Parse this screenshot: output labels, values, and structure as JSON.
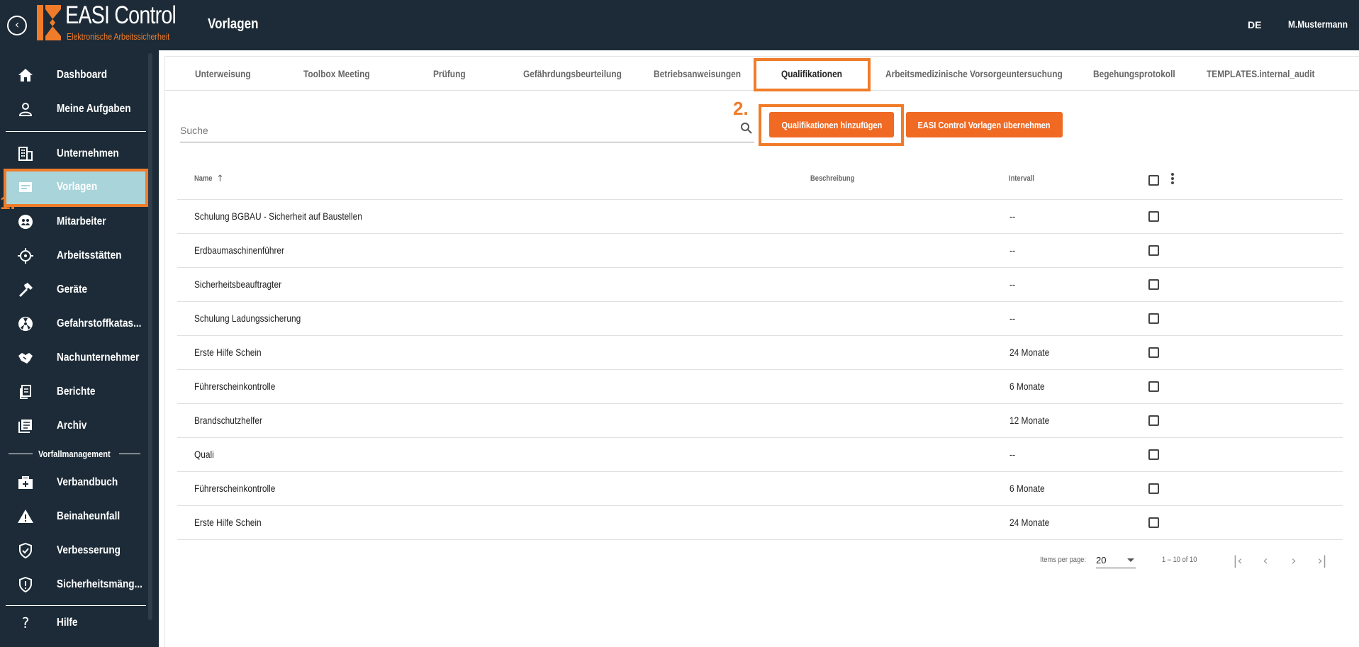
{
  "app": {
    "title": "EASI Control",
    "subtitle": "Elektronische Arbeitssicherheit",
    "page_title": "Vorlagen",
    "language": "DE",
    "user": "M.Mustermann",
    "brand_color": "#f07c2a",
    "header_bg": "#1c2b37"
  },
  "sidebar": {
    "items": [
      {
        "label": "Dashboard",
        "icon": "home-icon"
      },
      {
        "label": "Meine Aufgaben",
        "icon": "person-icon"
      },
      {
        "label": "Unternehmen",
        "icon": "building-icon"
      },
      {
        "label": "Vorlagen",
        "icon": "template-icon",
        "active": true
      },
      {
        "label": "Mitarbeiter",
        "icon": "people-icon"
      },
      {
        "label": "Arbeitsstätten",
        "icon": "crosshair-icon"
      },
      {
        "label": "Geräte",
        "icon": "hammer-icon"
      },
      {
        "label": "Gefahrstoffkatas...",
        "icon": "radiation-icon"
      },
      {
        "label": "Nachunternehmer",
        "icon": "handshake-icon"
      },
      {
        "label": "Berichte",
        "icon": "report-icon"
      },
      {
        "label": "Archiv",
        "icon": "archive-icon"
      }
    ],
    "section_label": "Vorfallmanagement",
    "incident_items": [
      {
        "label": "Verbandbuch",
        "icon": "first-aid-icon"
      },
      {
        "label": "Beinaheunfall",
        "icon": "warning-icon"
      },
      {
        "label": "Verbesserung",
        "icon": "shield-check-icon"
      },
      {
        "label": "Sicherheitsmäng...",
        "icon": "shield-alert-icon"
      }
    ],
    "help": {
      "label": "Hilfe",
      "icon": "question-icon"
    }
  },
  "annotations": {
    "step1": "1.",
    "step2": "2."
  },
  "tabs": [
    {
      "label": "Unterweisung"
    },
    {
      "label": "Toolbox Meeting"
    },
    {
      "label": "Prüfung"
    },
    {
      "label": "Gefährdungsbeurteilung"
    },
    {
      "label": "Betriebsanweisungen"
    },
    {
      "label": "Qualifikationen",
      "active": true
    },
    {
      "label": "Arbeitsmedizinische Vorsorgeuntersuchung"
    },
    {
      "label": "Begehungsprotokoll"
    },
    {
      "label": "TEMPLATES.internal_audit"
    }
  ],
  "search": {
    "placeholder": "Suche",
    "value": ""
  },
  "buttons": {
    "add": "Qualifikationen hinzufügen",
    "adopt": "EASI Control Vorlagen übernehmen"
  },
  "table": {
    "columns": {
      "name": "Name",
      "description": "Beschreibung",
      "interval": "Intervall"
    },
    "rows": [
      {
        "name": "Schulung BGBAU - Sicherheit auf Baustellen",
        "description": "",
        "interval": "--"
      },
      {
        "name": "Erdbaumaschinenführer",
        "description": "",
        "interval": "--"
      },
      {
        "name": "Sicherheitsbeauftragter",
        "description": "",
        "interval": "--"
      },
      {
        "name": "Schulung Ladungssicherung",
        "description": "",
        "interval": "--"
      },
      {
        "name": "Erste Hilfe Schein",
        "description": "",
        "interval": "24 Monate"
      },
      {
        "name": "Führerscheinkontrolle",
        "description": "",
        "interval": "6 Monate"
      },
      {
        "name": "Brandschutzhelfer",
        "description": "",
        "interval": "12 Monate"
      },
      {
        "name": "Quali",
        "description": "",
        "interval": "--"
      },
      {
        "name": "Führerscheinkontrolle",
        "description": "",
        "interval": "6 Monate"
      },
      {
        "name": "Erste Hilfe Schein",
        "description": "",
        "interval": "24 Monate"
      }
    ]
  },
  "paginator": {
    "items_per_page_label": "Items per page:",
    "items_per_page": "20",
    "range": "1 – 10 of 10"
  }
}
